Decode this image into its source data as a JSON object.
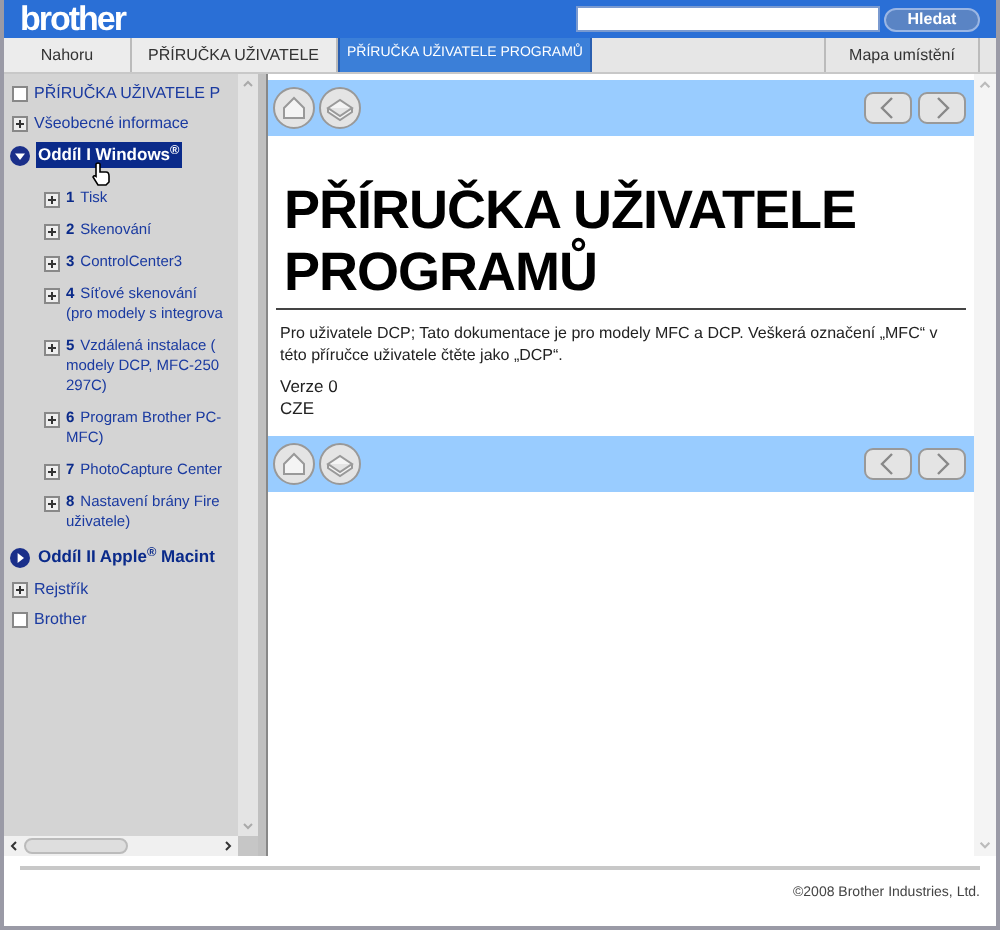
{
  "header": {
    "logo": "brother",
    "search_button": "Hledat"
  },
  "tabs": [
    {
      "label": "Nahoru",
      "selected": false
    },
    {
      "label": "PŘÍRUČKA UŽIVATELE",
      "selected": false
    },
    {
      "label": "PŘÍRUČKA UŽIVATELE PROGRAMŮ",
      "selected": true
    }
  ],
  "site_map_link": "Mapa umístění",
  "sidebar": {
    "items": [
      {
        "kind": "page",
        "label": "PŘÍRUČKA UŽIVATELE P"
      },
      {
        "kind": "collapsed",
        "label": "Všeobecné informace"
      },
      {
        "kind": "section",
        "expanded": true,
        "selected": true,
        "label": "Oddíl I Windows$^{®}$",
        "children": [
          {
            "kind": "collapsed",
            "number": "1",
            "lines": [
              "Tisk"
            ]
          },
          {
            "kind": "collapsed",
            "number": "2",
            "lines": [
              "Skenování"
            ]
          },
          {
            "kind": "collapsed",
            "number": "3",
            "lines": [
              "ControlCenter3"
            ]
          },
          {
            "kind": "collapsed",
            "number": "4",
            "lines": [
              "Síťové skenování",
              "(pro modely s integrova"
            ]
          },
          {
            "kind": "collapsed",
            "number": "5",
            "lines": [
              "Vzdálená instalace (",
              "modely DCP, MFC-250",
              "297C)"
            ]
          },
          {
            "kind": "collapsed",
            "number": "6",
            "lines": [
              "Program Brother PC-",
              "MFC)"
            ]
          },
          {
            "kind": "collapsed",
            "number": "7",
            "lines": [
              "PhotoCapture Center"
            ]
          },
          {
            "kind": "collapsed",
            "number": "8",
            "lines": [
              "Nastavení brány Fire",
              "uživatele)"
            ]
          }
        ]
      },
      {
        "kind": "section",
        "expanded": false,
        "selected": false,
        "label": "Oddíl II Apple$^{®}$ Macint"
      },
      {
        "kind": "collapsed",
        "label": "Rejstřík"
      },
      {
        "kind": "page",
        "label": "Brother"
      }
    ]
  },
  "main": {
    "title": "PŘÍRUČKA UŽIVATELE PROGRAMŮ",
    "paragraph": "Pro uživatele DCP; Tato dokumentace je pro modely MFC a DCP. Veškerá označení „MFC“ v této příručce uživatele čtěte jako „DCP“.",
    "version_lines": [
      "Verze 0",
      "CZE"
    ]
  },
  "footer": {
    "copyright": "©2008 Brother Industries, Ltd."
  }
}
